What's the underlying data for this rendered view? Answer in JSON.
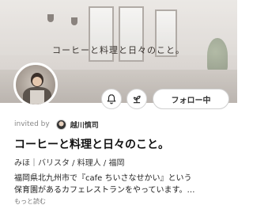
{
  "cover": {
    "title": "コーヒーと料理と日々のこと。"
  },
  "actions": {
    "notify_icon": "bell-icon",
    "tip_icon": "sprout-icon",
    "follow_label": "フォロー中"
  },
  "invited": {
    "label": "invited by",
    "inviter_name": "越川慎司"
  },
  "profile": {
    "title": "コーヒーと料理と日々のこと。",
    "tags": "みほ｜バリスタ / 料理人 / 福岡",
    "bio_line1": "福岡県北九州市で『cafe ちいさなせかい』という",
    "bio_line2": "保育園があるカフェレストランをやっています。…",
    "more_label": "もっと読む"
  }
}
